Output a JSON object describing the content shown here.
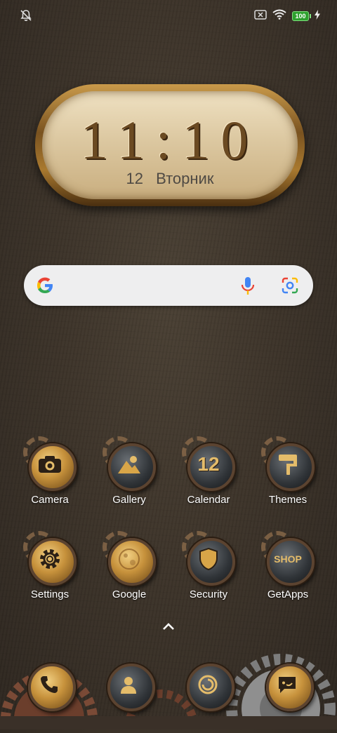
{
  "status_bar": {
    "left_icons": [
      "notifications-off-icon"
    ],
    "right_icons": [
      "sim-missing-icon",
      "wifi-icon",
      "battery-icon",
      "charging-icon"
    ],
    "battery_level": "100"
  },
  "clock_widget": {
    "time": "11:10",
    "day": "12",
    "weekday": "Вторник"
  },
  "search_bar": {
    "icons": [
      "google-g-icon",
      "microphone-icon",
      "google-lens-icon"
    ]
  },
  "apps": [
    {
      "label": "Camera",
      "icon": "camera-icon"
    },
    {
      "label": "Gallery",
      "icon": "gallery-icon"
    },
    {
      "label": "Calendar",
      "icon": "calendar-icon",
      "badge": "12"
    },
    {
      "label": "Themes",
      "icon": "themes-icon"
    },
    {
      "label": "Settings",
      "icon": "settings-icon"
    },
    {
      "label": "Google",
      "icon": "google-icon"
    },
    {
      "label": "Security",
      "icon": "security-icon"
    },
    {
      "label": "GetApps",
      "icon": "getapps-icon",
      "badge": "SHOP"
    }
  ],
  "app_drawer": {
    "icon": "chevron-up-icon"
  },
  "dock": [
    {
      "icon": "phone-icon"
    },
    {
      "icon": "contacts-icon"
    },
    {
      "icon": "browser-icon"
    },
    {
      "icon": "messages-icon"
    }
  ],
  "colors": {
    "wallpaper": "#3d342a",
    "brass": "#c7923c",
    "search_bg": "#eeeeef",
    "battery_green": "#2ea12e"
  }
}
